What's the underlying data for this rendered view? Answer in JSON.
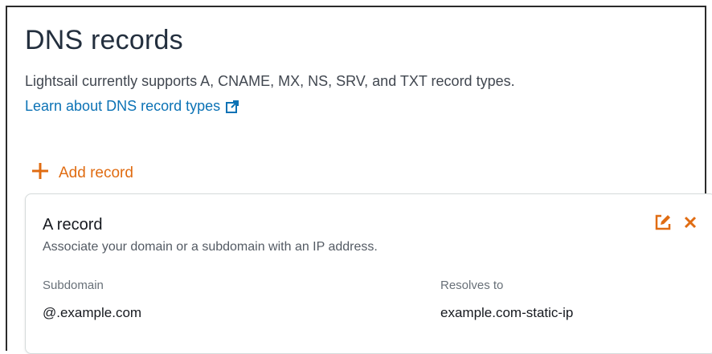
{
  "section": {
    "title": "DNS records",
    "description": "Lightsail currently supports A, CNAME, MX, NS, SRV, and TXT record types.",
    "learn_link": "Learn about DNS record types"
  },
  "add_record": {
    "label": "Add record",
    "icon": "plus-icon"
  },
  "record": {
    "title": "A record",
    "subtitle": "Associate your domain or a subdomain with an IP address.",
    "subdomain_label": "Subdomain",
    "subdomain_value": "@.example.com",
    "resolves_label": "Resolves to",
    "resolves_value": "example.com-static-ip",
    "actions": [
      "edit-icon",
      "close-icon"
    ]
  },
  "colors": {
    "accent": "#e06c12",
    "link": "#0b72b5",
    "title": "#232f3e"
  }
}
